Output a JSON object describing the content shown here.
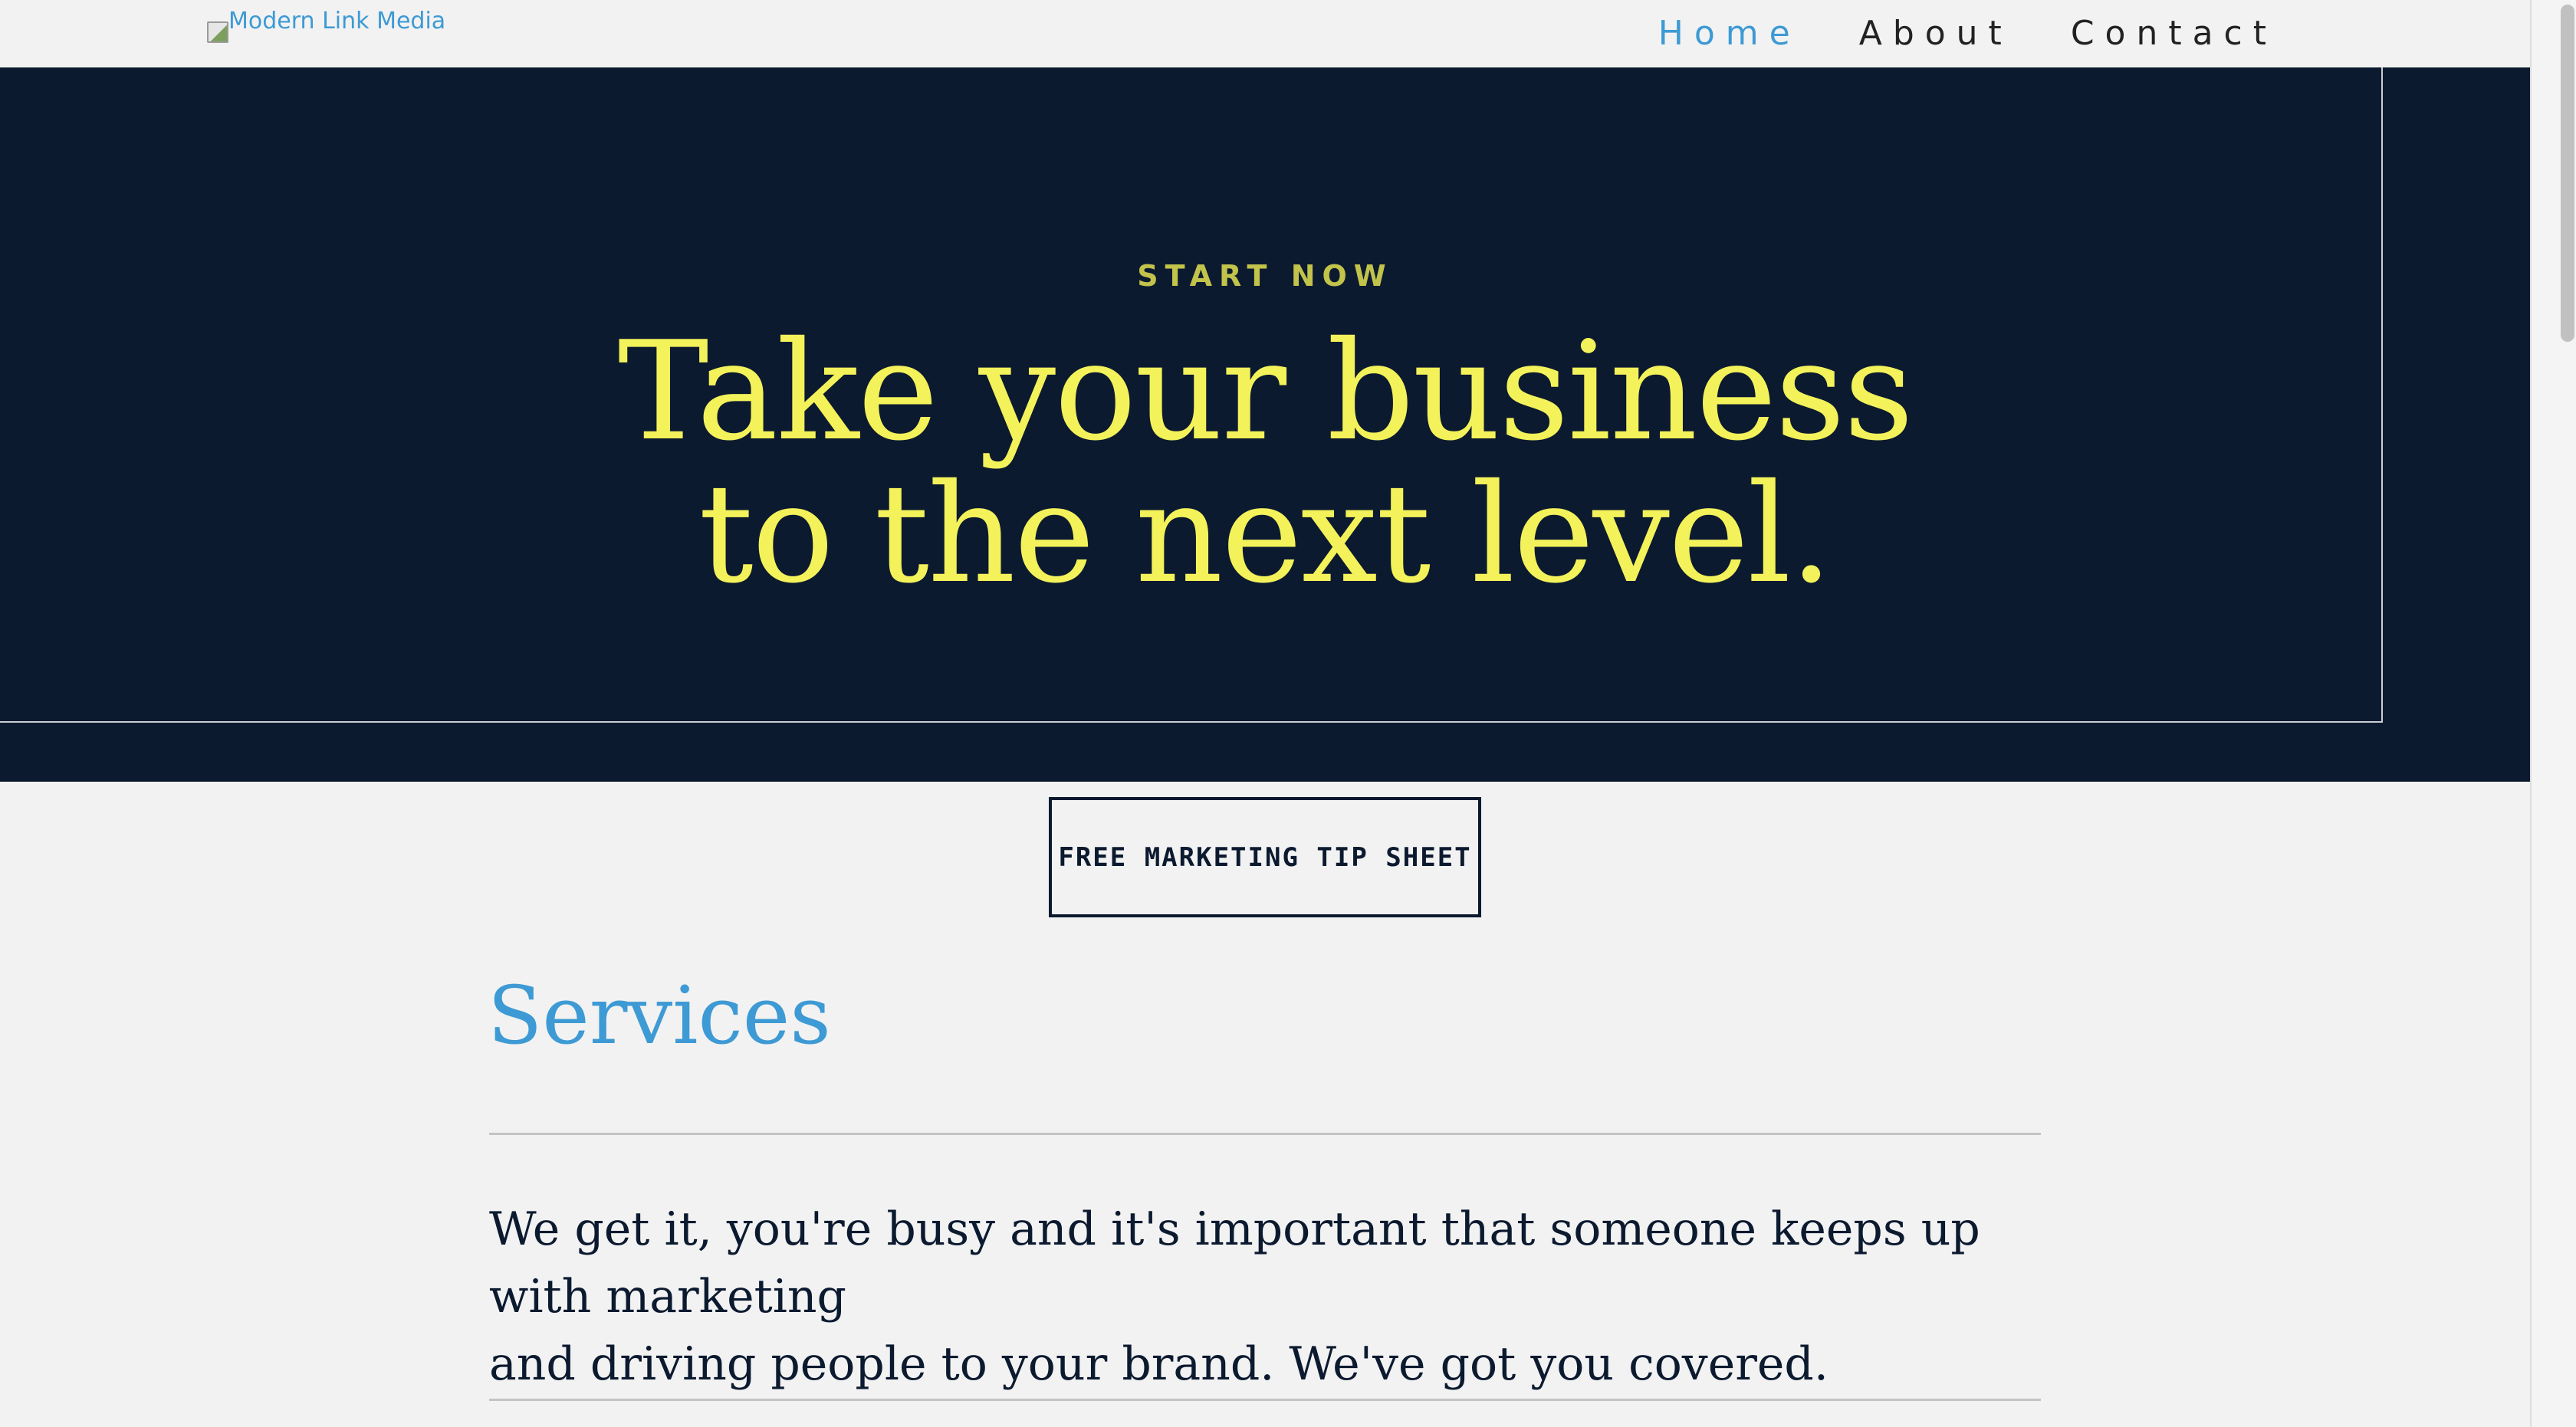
{
  "header": {
    "logo_text": "Modern Link Media",
    "nav": [
      {
        "label": "Home",
        "active": true
      },
      {
        "label": "About",
        "active": false
      },
      {
        "label": "Contact",
        "active": false
      }
    ]
  },
  "hero": {
    "kicker": "START NOW",
    "title_line1": "Take your business",
    "title_line2": "to the next level."
  },
  "cta": {
    "label": "FREE MARKETING TIP SHEET"
  },
  "services": {
    "title": "Services",
    "body_line1": "We get it, you're busy and it's important that someone keeps up with marketing",
    "body_line2": "and driving people to your brand. We've got you covered."
  },
  "colors": {
    "accent_blue": "#3d9ad4",
    "hero_bg": "#0c1a30",
    "hero_title": "#f3f25a",
    "kicker": "#c2c34a",
    "page_bg": "#f2f2f2"
  }
}
